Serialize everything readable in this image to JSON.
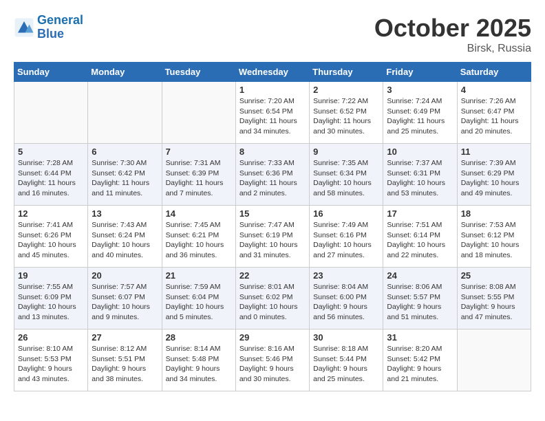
{
  "header": {
    "logo_line1": "General",
    "logo_line2": "Blue",
    "month": "October 2025",
    "location": "Birsk, Russia"
  },
  "days_of_week": [
    "Sunday",
    "Monday",
    "Tuesday",
    "Wednesday",
    "Thursday",
    "Friday",
    "Saturday"
  ],
  "weeks": [
    [
      {
        "day": "",
        "text": ""
      },
      {
        "day": "",
        "text": ""
      },
      {
        "day": "",
        "text": ""
      },
      {
        "day": "1",
        "text": "Sunrise: 7:20 AM\nSunset: 6:54 PM\nDaylight: 11 hours and 34 minutes."
      },
      {
        "day": "2",
        "text": "Sunrise: 7:22 AM\nSunset: 6:52 PM\nDaylight: 11 hours and 30 minutes."
      },
      {
        "day": "3",
        "text": "Sunrise: 7:24 AM\nSunset: 6:49 PM\nDaylight: 11 hours and 25 minutes."
      },
      {
        "day": "4",
        "text": "Sunrise: 7:26 AM\nSunset: 6:47 PM\nDaylight: 11 hours and 20 minutes."
      }
    ],
    [
      {
        "day": "5",
        "text": "Sunrise: 7:28 AM\nSunset: 6:44 PM\nDaylight: 11 hours and 16 minutes."
      },
      {
        "day": "6",
        "text": "Sunrise: 7:30 AM\nSunset: 6:42 PM\nDaylight: 11 hours and 11 minutes."
      },
      {
        "day": "7",
        "text": "Sunrise: 7:31 AM\nSunset: 6:39 PM\nDaylight: 11 hours and 7 minutes."
      },
      {
        "day": "8",
        "text": "Sunrise: 7:33 AM\nSunset: 6:36 PM\nDaylight: 11 hours and 2 minutes."
      },
      {
        "day": "9",
        "text": "Sunrise: 7:35 AM\nSunset: 6:34 PM\nDaylight: 10 hours and 58 minutes."
      },
      {
        "day": "10",
        "text": "Sunrise: 7:37 AM\nSunset: 6:31 PM\nDaylight: 10 hours and 53 minutes."
      },
      {
        "day": "11",
        "text": "Sunrise: 7:39 AM\nSunset: 6:29 PM\nDaylight: 10 hours and 49 minutes."
      }
    ],
    [
      {
        "day": "12",
        "text": "Sunrise: 7:41 AM\nSunset: 6:26 PM\nDaylight: 10 hours and 45 minutes."
      },
      {
        "day": "13",
        "text": "Sunrise: 7:43 AM\nSunset: 6:24 PM\nDaylight: 10 hours and 40 minutes."
      },
      {
        "day": "14",
        "text": "Sunrise: 7:45 AM\nSunset: 6:21 PM\nDaylight: 10 hours and 36 minutes."
      },
      {
        "day": "15",
        "text": "Sunrise: 7:47 AM\nSunset: 6:19 PM\nDaylight: 10 hours and 31 minutes."
      },
      {
        "day": "16",
        "text": "Sunrise: 7:49 AM\nSunset: 6:16 PM\nDaylight: 10 hours and 27 minutes."
      },
      {
        "day": "17",
        "text": "Sunrise: 7:51 AM\nSunset: 6:14 PM\nDaylight: 10 hours and 22 minutes."
      },
      {
        "day": "18",
        "text": "Sunrise: 7:53 AM\nSunset: 6:12 PM\nDaylight: 10 hours and 18 minutes."
      }
    ],
    [
      {
        "day": "19",
        "text": "Sunrise: 7:55 AM\nSunset: 6:09 PM\nDaylight: 10 hours and 13 minutes."
      },
      {
        "day": "20",
        "text": "Sunrise: 7:57 AM\nSunset: 6:07 PM\nDaylight: 10 hours and 9 minutes."
      },
      {
        "day": "21",
        "text": "Sunrise: 7:59 AM\nSunset: 6:04 PM\nDaylight: 10 hours and 5 minutes."
      },
      {
        "day": "22",
        "text": "Sunrise: 8:01 AM\nSunset: 6:02 PM\nDaylight: 10 hours and 0 minutes."
      },
      {
        "day": "23",
        "text": "Sunrise: 8:04 AM\nSunset: 6:00 PM\nDaylight: 9 hours and 56 minutes."
      },
      {
        "day": "24",
        "text": "Sunrise: 8:06 AM\nSunset: 5:57 PM\nDaylight: 9 hours and 51 minutes."
      },
      {
        "day": "25",
        "text": "Sunrise: 8:08 AM\nSunset: 5:55 PM\nDaylight: 9 hours and 47 minutes."
      }
    ],
    [
      {
        "day": "26",
        "text": "Sunrise: 8:10 AM\nSunset: 5:53 PM\nDaylight: 9 hours and 43 minutes."
      },
      {
        "day": "27",
        "text": "Sunrise: 8:12 AM\nSunset: 5:51 PM\nDaylight: 9 hours and 38 minutes."
      },
      {
        "day": "28",
        "text": "Sunrise: 8:14 AM\nSunset: 5:48 PM\nDaylight: 9 hours and 34 minutes."
      },
      {
        "day": "29",
        "text": "Sunrise: 8:16 AM\nSunset: 5:46 PM\nDaylight: 9 hours and 30 minutes."
      },
      {
        "day": "30",
        "text": "Sunrise: 8:18 AM\nSunset: 5:44 PM\nDaylight: 9 hours and 25 minutes."
      },
      {
        "day": "31",
        "text": "Sunrise: 8:20 AM\nSunset: 5:42 PM\nDaylight: 9 hours and 21 minutes."
      },
      {
        "day": "",
        "text": ""
      }
    ]
  ]
}
